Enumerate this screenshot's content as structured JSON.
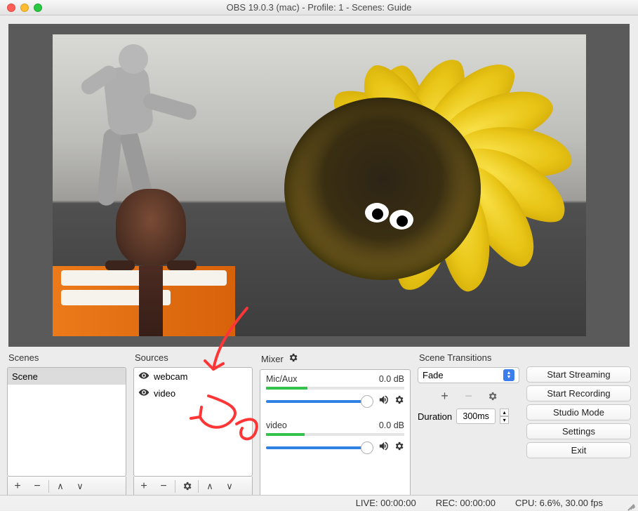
{
  "window": {
    "title": "OBS 19.0.3 (mac) - Profile: 1 - Scenes: Guide"
  },
  "panels": {
    "scenes_label": "Scenes",
    "sources_label": "Sources",
    "mixer_label": "Mixer",
    "transitions_label": "Scene Transitions"
  },
  "scenes": {
    "items": [
      "Scene"
    ]
  },
  "sources": {
    "items": [
      {
        "name": "webcam"
      },
      {
        "name": "video"
      }
    ]
  },
  "mixer": {
    "channels": [
      {
        "name": "Mic/Aux",
        "db": "0.0 dB",
        "meter": 0.3
      },
      {
        "name": "video",
        "db": "0.0 dB",
        "meter": 0.28
      }
    ]
  },
  "transitions": {
    "selected": "Fade",
    "duration_label": "Duration",
    "duration_value": "300ms"
  },
  "buttons": {
    "start_streaming": "Start Streaming",
    "start_recording": "Start Recording",
    "studio_mode": "Studio Mode",
    "settings": "Settings",
    "exit": "Exit"
  },
  "status": {
    "live": "LIVE: 00:00:00",
    "rec": "REC: 00:00:00",
    "cpu": "CPU: 6.6%, 30.00 fps"
  },
  "icons": {
    "plus": "+",
    "minus": "−",
    "up": "∧",
    "down": "∨"
  }
}
